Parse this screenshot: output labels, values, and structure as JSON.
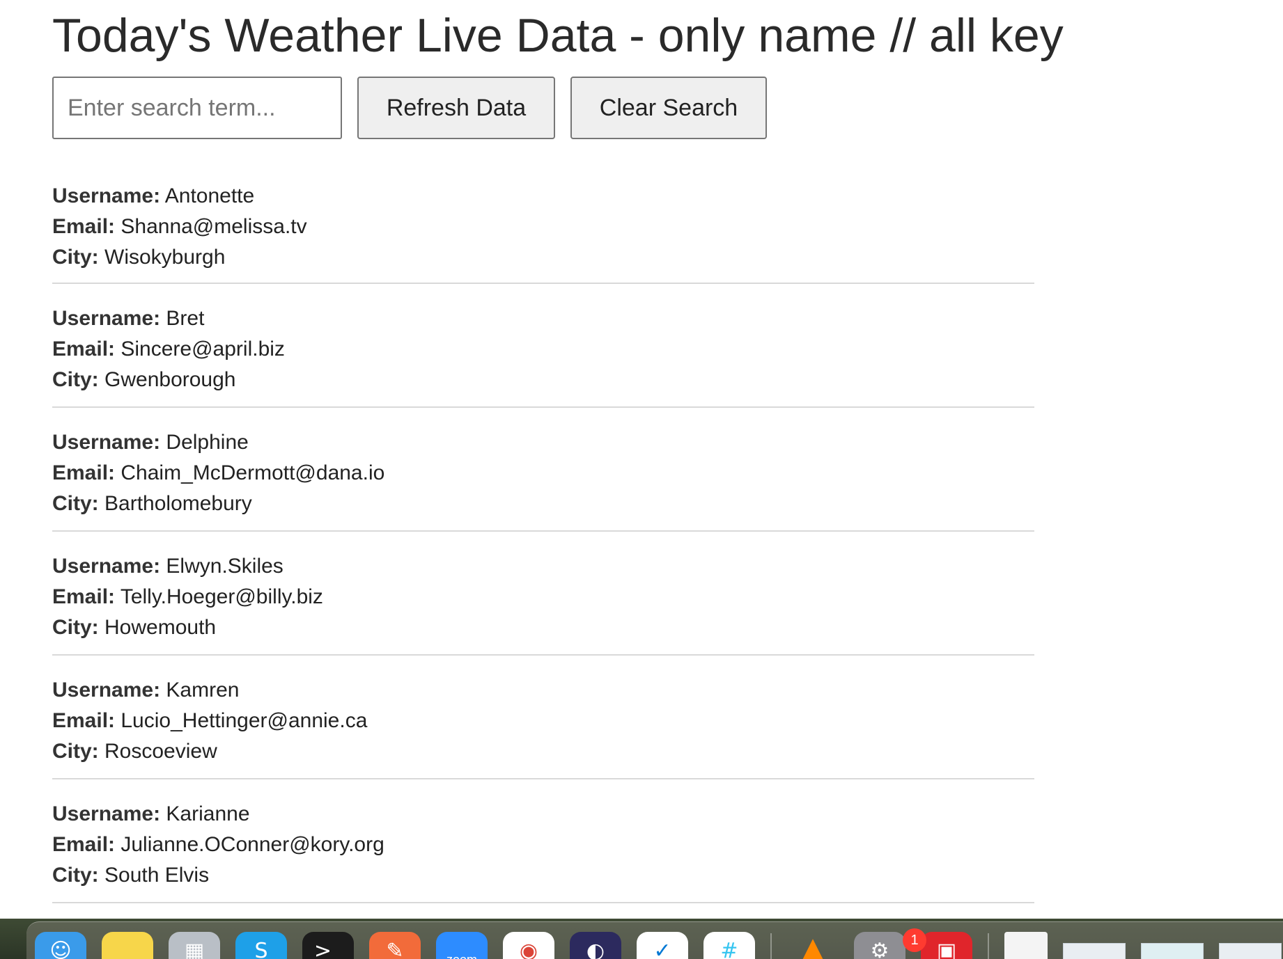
{
  "page": {
    "title": "Today's Weather Live Data - only name // all key"
  },
  "controls": {
    "search_placeholder": "Enter search term...",
    "search_value": "",
    "refresh_label": "Refresh Data",
    "clear_label": "Clear Search"
  },
  "labels": {
    "username": "Username:",
    "email": "Email:",
    "city": "City:"
  },
  "users": [
    {
      "username": "Antonette",
      "email": "Shanna@melissa.tv",
      "city": "Wisokyburgh"
    },
    {
      "username": "Bret",
      "email": "Sincere@april.biz",
      "city": "Gwenborough"
    },
    {
      "username": "Delphine",
      "email": "Chaim_McDermott@dana.io",
      "city": "Bartholomebury"
    },
    {
      "username": "Elwyn.Skiles",
      "email": "Telly.Hoeger@billy.biz",
      "city": "Howemouth"
    },
    {
      "username": "Kamren",
      "email": "Lucio_Hettinger@annie.ca",
      "city": "Roscoeview"
    },
    {
      "username": "Karianne",
      "email": "Julianne.OConner@kory.org",
      "city": "South Elvis"
    }
  ],
  "dock": {
    "items": [
      {
        "name": "finder-icon",
        "color": "#3a9bea"
      },
      {
        "name": "notes-icon",
        "color": "#f7d64a"
      },
      {
        "name": "launchpad-icon",
        "color": "#b9bfc6"
      },
      {
        "name": "skype-icon",
        "color": "#1ea0e8"
      },
      {
        "name": "terminal-icon",
        "color": "#1c1c1c"
      },
      {
        "name": "postman-icon",
        "color": "#f26b3a"
      },
      {
        "name": "zoom-icon",
        "color": "#2d8cff"
      },
      {
        "name": "chrome-icon",
        "color": "#ffffff"
      },
      {
        "name": "eclipse-icon",
        "color": "#2c2a5e"
      },
      {
        "name": "vscode-icon",
        "color": "#ffffff"
      },
      {
        "name": "slack-icon",
        "color": "#ffffff"
      },
      {
        "name": "vlc-icon",
        "color": "#ff8800"
      },
      {
        "name": "system-preferences-icon",
        "color": "#8e8e93"
      },
      {
        "name": "photo-booth-icon",
        "color": "#e0252b"
      }
    ],
    "zoom_text": "zoom",
    "system_prefs_badge": "1"
  }
}
